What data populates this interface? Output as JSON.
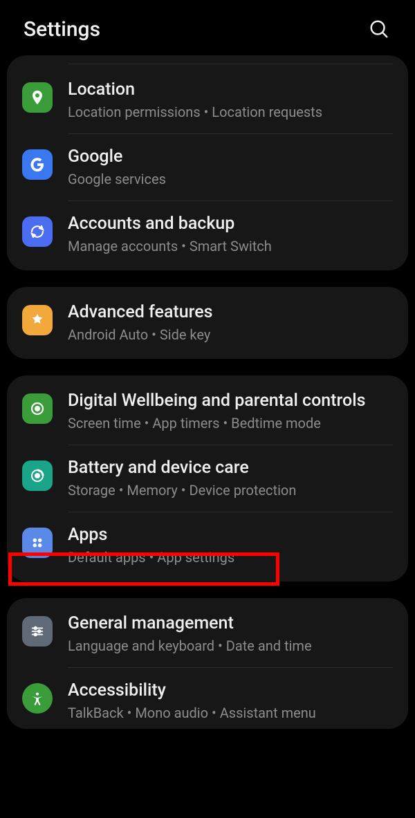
{
  "header": {
    "title": "Settings"
  },
  "groups": [
    {
      "items": [
        {
          "key": "location",
          "title": "Location",
          "sub": "Location permissions  •  Location requests",
          "icon_bg": "#3a9d3a"
        },
        {
          "key": "google",
          "title": "Google",
          "sub": "Google services",
          "icon_bg": "#3978f0"
        },
        {
          "key": "accounts",
          "title": "Accounts and backup",
          "sub": "Manage accounts  •  Smart Switch",
          "icon_bg": "#4b6df2"
        }
      ]
    },
    {
      "items": [
        {
          "key": "advanced",
          "title": "Advanced features",
          "sub": "Android Auto  •  Side key",
          "icon_bg": "#f2a83a"
        }
      ]
    },
    {
      "items": [
        {
          "key": "wellbeing",
          "title": "Digital Wellbeing and parental controls",
          "sub": "Screen time  •  App timers  •  Bedtime mode",
          "icon_bg": "#3a9d3a"
        },
        {
          "key": "battery",
          "title": "Battery and device care",
          "sub": "Storage  •  Memory  •  Device protection",
          "icon_bg": "#1aa58a"
        },
        {
          "key": "apps",
          "title": "Apps",
          "sub": "Default apps  •  App settings",
          "icon_bg": "#5b89e8",
          "highlight": true
        }
      ]
    },
    {
      "items": [
        {
          "key": "general",
          "title": "General management",
          "sub": "Language and keyboard  •  Date and time",
          "icon_bg": "#5f6a76"
        },
        {
          "key": "accessibility",
          "title": "Accessibility",
          "sub": "TalkBack  •  Mono audio  •  Assistant menu",
          "icon_bg": "#3a9d3a"
        }
      ]
    }
  ]
}
